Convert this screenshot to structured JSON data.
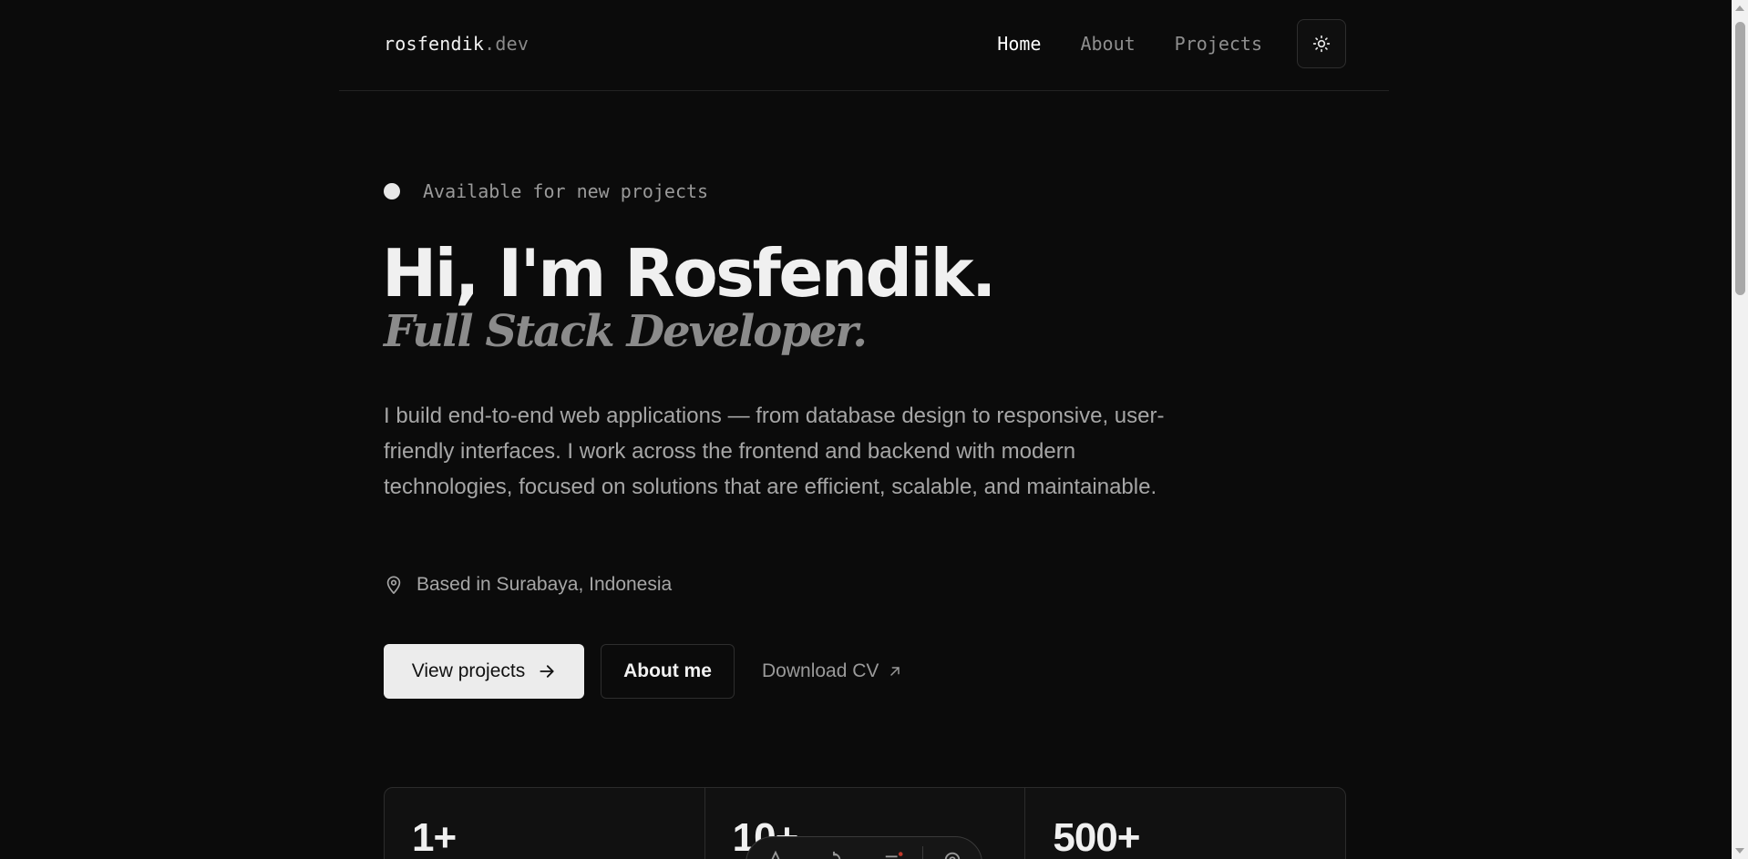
{
  "header": {
    "logo_name": "rosfendik",
    "logo_tld": ".dev",
    "nav": [
      {
        "label": "Home",
        "active": true
      },
      {
        "label": "About",
        "active": false
      },
      {
        "label": "Projects",
        "active": false
      }
    ],
    "theme_toggle_icon": "sun-icon"
  },
  "hero": {
    "status_text": "Available for new projects",
    "title": "Hi, I'm Rosfendik.",
    "subtitle": "Full Stack Developer.",
    "description": "I build end-to-end web applications — from database design to responsive, user-friendly interfaces. I work across the frontend and backend with modern technologies, focused on solutions that are efficient, scalable, and maintainable.",
    "location": "Based in Surabaya, Indonesia",
    "location_icon": "map-pin-icon"
  },
  "actions": {
    "primary_label": "View projects",
    "primary_icon": "arrow-right-icon",
    "secondary_label": "About me",
    "link_label": "Download CV",
    "link_icon": "arrow-up-right-icon"
  },
  "stats": [
    {
      "value": "1+"
    },
    {
      "value": "10+"
    },
    {
      "value": "500+"
    }
  ],
  "colors": {
    "background": "#0b0b0b",
    "text": "#ececec",
    "muted": "#8f8f8f",
    "border": "#2c2c2c"
  }
}
